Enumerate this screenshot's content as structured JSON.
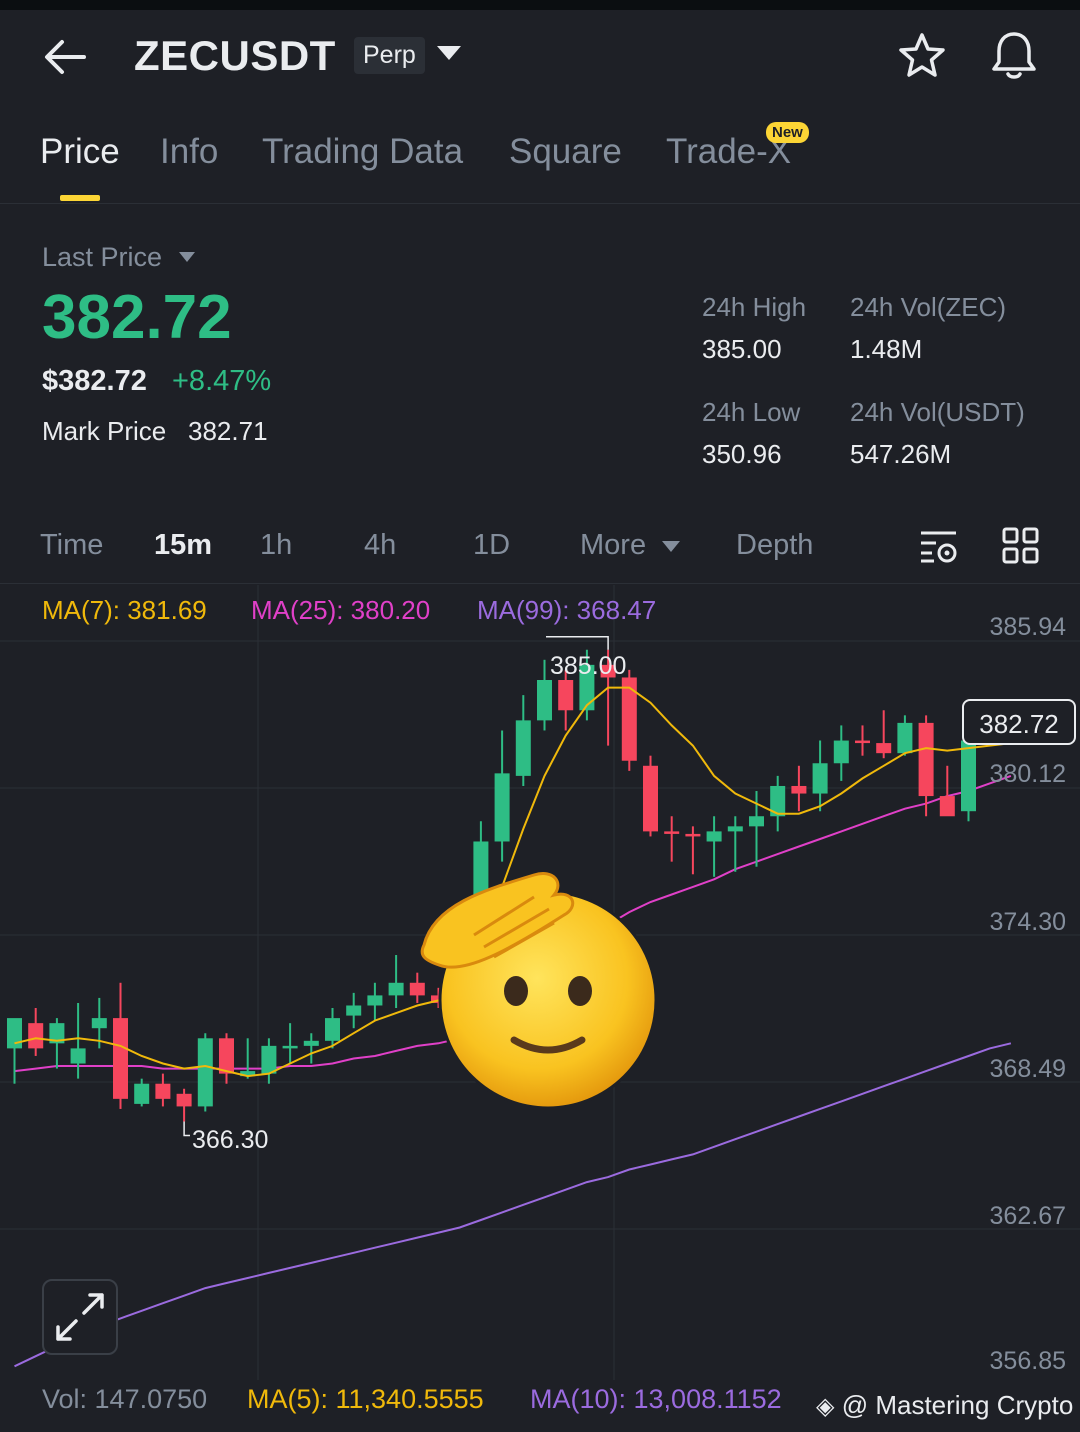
{
  "header": {
    "symbol": "ZECUSDT",
    "contract_type": "Perp"
  },
  "tabs": [
    {
      "label": "Price",
      "active": true
    },
    {
      "label": "Info"
    },
    {
      "label": "Trading Data"
    },
    {
      "label": "Square"
    },
    {
      "label": "Trade-X",
      "badge": "New"
    }
  ],
  "ticker": {
    "last_price_label": "Last Price",
    "last_price": "382.72",
    "usd_price": "$382.72",
    "change_pct": "+8.47%",
    "mark_price_label": "Mark Price",
    "mark_price": "382.71",
    "high_label": "24h High",
    "high": "385.00",
    "low_label": "24h Low",
    "low": "350.96",
    "vol_zec_label": "24h Vol(ZEC)",
    "vol_zec": "1.48M",
    "vol_usdt_label": "24h Vol(USDT)",
    "vol_usdt": "547.26M"
  },
  "timeframes": {
    "time": "Time",
    "m15": "15m",
    "h1": "1h",
    "h4": "4h",
    "d1": "1D",
    "more": "More",
    "depth": "Depth",
    "selected": "15m"
  },
  "indicators": {
    "ma7": "MA(7): 381.69",
    "ma25": "MA(25): 380.20",
    "ma99": "MA(99): 368.47"
  },
  "colors": {
    "up": "#2ebd85",
    "down": "#f6465d",
    "ma7": "#f0b90b",
    "ma25": "#e040c8",
    "ma99": "#9b6bdf",
    "accent": "#fcd535"
  },
  "chart_data": {
    "type": "candlestick",
    "y_ticks": [
      "385.94",
      "380.12",
      "374.30",
      "368.49",
      "362.67",
      "356.85"
    ],
    "y_range": [
      356.85,
      385.94
    ],
    "current_price": "382.72",
    "high_annotation": "385.00",
    "low_annotation": "366.30",
    "candles": [
      {
        "o": 369.2,
        "h": 370.0,
        "l": 367.8,
        "c": 370.4
      },
      {
        "o": 370.2,
        "h": 370.8,
        "l": 368.9,
        "c": 369.2
      },
      {
        "o": 369.4,
        "h": 370.4,
        "l": 368.4,
        "c": 370.2
      },
      {
        "o": 368.6,
        "h": 371.0,
        "l": 368.0,
        "c": 369.2
      },
      {
        "o": 370.0,
        "h": 371.2,
        "l": 369.2,
        "c": 370.4
      },
      {
        "o": 370.4,
        "h": 371.8,
        "l": 366.8,
        "c": 367.2
      },
      {
        "o": 367.0,
        "h": 368.0,
        "l": 366.9,
        "c": 367.8
      },
      {
        "o": 367.8,
        "h": 368.2,
        "l": 366.9,
        "c": 367.2
      },
      {
        "o": 367.4,
        "h": 367.6,
        "l": 366.3,
        "c": 366.9
      },
      {
        "o": 366.9,
        "h": 369.8,
        "l": 366.7,
        "c": 369.6
      },
      {
        "o": 369.6,
        "h": 369.8,
        "l": 367.8,
        "c": 368.2
      },
      {
        "o": 368.1,
        "h": 369.6,
        "l": 368.0,
        "c": 368.3
      },
      {
        "o": 368.2,
        "h": 369.6,
        "l": 367.8,
        "c": 369.3
      },
      {
        "o": 369.2,
        "h": 370.2,
        "l": 368.6,
        "c": 369.3
      },
      {
        "o": 369.3,
        "h": 369.8,
        "l": 368.6,
        "c": 369.5
      },
      {
        "o": 369.5,
        "h": 370.8,
        "l": 369.2,
        "c": 370.4
      },
      {
        "o": 370.5,
        "h": 371.4,
        "l": 370.0,
        "c": 370.9
      },
      {
        "o": 370.9,
        "h": 371.8,
        "l": 370.3,
        "c": 371.3
      },
      {
        "o": 371.3,
        "h": 372.9,
        "l": 370.8,
        "c": 371.8
      },
      {
        "o": 371.8,
        "h": 372.2,
        "l": 371.0,
        "c": 371.3
      },
      {
        "o": 371.3,
        "h": 371.6,
        "l": 370.8,
        "c": 371.0
      },
      {
        "o": 370.8,
        "h": 372.4,
        "l": 370.6,
        "c": 371.6
      },
      {
        "o": 371.2,
        "h": 378.2,
        "l": 369.6,
        "c": 377.4
      },
      {
        "o": 377.4,
        "h": 381.8,
        "l": 376.6,
        "c": 380.1
      },
      {
        "o": 380.0,
        "h": 383.2,
        "l": 379.6,
        "c": 382.2
      },
      {
        "o": 382.2,
        "h": 384.6,
        "l": 381.8,
        "c": 383.8
      },
      {
        "o": 383.8,
        "h": 384.2,
        "l": 381.8,
        "c": 382.6
      },
      {
        "o": 382.6,
        "h": 385.0,
        "l": 382.2,
        "c": 384.4
      },
      {
        "o": 384.4,
        "h": 385.0,
        "l": 381.2,
        "c": 383.9
      },
      {
        "o": 383.9,
        "h": 384.2,
        "l": 380.2,
        "c": 380.6
      },
      {
        "o": 380.4,
        "h": 380.8,
        "l": 377.6,
        "c": 377.8
      },
      {
        "o": 377.8,
        "h": 378.4,
        "l": 376.6,
        "c": 377.7
      },
      {
        "o": 377.7,
        "h": 378.0,
        "l": 376.1,
        "c": 377.6
      },
      {
        "o": 377.4,
        "h": 378.4,
        "l": 376.0,
        "c": 377.8
      },
      {
        "o": 377.8,
        "h": 378.4,
        "l": 376.2,
        "c": 378.0
      },
      {
        "o": 378.0,
        "h": 379.4,
        "l": 376.4,
        "c": 378.4
      },
      {
        "o": 378.4,
        "h": 380.0,
        "l": 377.8,
        "c": 379.6
      },
      {
        "o": 379.6,
        "h": 380.4,
        "l": 378.6,
        "c": 379.3
      },
      {
        "o": 379.3,
        "h": 381.4,
        "l": 378.6,
        "c": 380.5
      },
      {
        "o": 380.5,
        "h": 382.0,
        "l": 379.8,
        "c": 381.4
      },
      {
        "o": 381.4,
        "h": 382.0,
        "l": 380.8,
        "c": 381.3
      },
      {
        "o": 381.3,
        "h": 382.6,
        "l": 380.7,
        "c": 380.9
      },
      {
        "o": 380.9,
        "h": 382.4,
        "l": 380.8,
        "c": 382.1
      },
      {
        "o": 382.1,
        "h": 382.4,
        "l": 378.4,
        "c": 379.2
      },
      {
        "o": 379.2,
        "h": 380.4,
        "l": 378.6,
        "c": 378.4
      },
      {
        "o": 378.6,
        "h": 382.4,
        "l": 378.2,
        "c": 381.4
      },
      {
        "o": 381.4,
        "h": 383.0,
        "l": 381.2,
        "c": 381.8
      },
      {
        "o": 381.8,
        "h": 382.2,
        "l": 381.6,
        "c": 382.0
      }
    ],
    "ma7_points": [
      369.4,
      369.6,
      369.5,
      369.6,
      369.5,
      369.3,
      368.9,
      368.6,
      368.4,
      368.5,
      368.3,
      368.1,
      368.2,
      368.6,
      369.0,
      369.3,
      369.8,
      370.3,
      370.6,
      370.9,
      371.1,
      371.4,
      373.3,
      375.6,
      377.9,
      380.0,
      381.6,
      382.8,
      383.5,
      383.5,
      382.9,
      382.0,
      381.2,
      380.0,
      379.3,
      378.9,
      378.5,
      378.5,
      378.8,
      379.3,
      379.9,
      380.4,
      380.9,
      381.1,
      381.0,
      381.1,
      381.2,
      381.3
    ],
    "ma25_points": [
      368.3,
      368.4,
      368.5,
      368.5,
      368.5,
      368.5,
      368.5,
      368.4,
      368.4,
      368.4,
      368.4,
      368.4,
      368.4,
      368.5,
      368.5,
      368.6,
      368.8,
      368.9,
      369.1,
      369.3,
      369.4,
      369.6,
      370.2,
      370.8,
      371.5,
      372.1,
      372.8,
      373.4,
      374.1,
      374.6,
      375.0,
      375.3,
      375.6,
      375.9,
      376.3,
      376.6,
      376.9,
      377.2,
      377.5,
      377.8,
      378.1,
      378.4,
      378.7,
      378.9,
      379.2,
      379.4,
      379.7,
      380.0
    ],
    "ma99_points": [
      356.6,
      357.0,
      357.4,
      357.8,
      358.2,
      358.5,
      358.8,
      359.1,
      359.4,
      359.7,
      359.9,
      360.1,
      360.3,
      360.5,
      360.7,
      360.9,
      361.1,
      361.3,
      361.5,
      361.7,
      361.9,
      362.1,
      362.4,
      362.7,
      363.0,
      363.3,
      363.6,
      363.9,
      364.1,
      364.4,
      364.6,
      364.8,
      365.0,
      365.3,
      365.6,
      365.9,
      366.2,
      366.5,
      366.8,
      367.1,
      367.4,
      367.7,
      368.0,
      368.3,
      368.6,
      368.9,
      369.2,
      369.4
    ]
  },
  "volume": {
    "vol": "Vol: 147.0750",
    "ma5": "MA(5): 11,340.5555",
    "ma10": "MA(10): 13,008.1152"
  },
  "watermark": "@ Mastering Crypto"
}
